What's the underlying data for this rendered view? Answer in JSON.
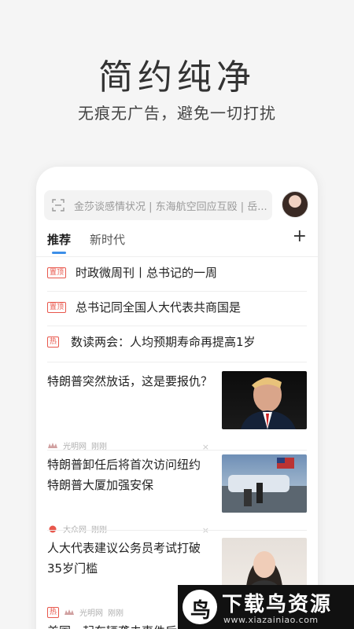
{
  "hero": {
    "title": "简约纯净",
    "subtitle": "无痕无广告，避免一切打扰"
  },
  "search": {
    "placeholder": "金莎谈感情状况 | 东海航空回应互殴 | 岳..."
  },
  "tabs": [
    {
      "label": "推荐",
      "active": true
    },
    {
      "label": "新时代",
      "active": false
    }
  ],
  "add_label": "+",
  "top_items": [
    {
      "badge": "置顶",
      "text": "时政微周刊丨总书记的一周"
    },
    {
      "badge": "置顶",
      "text": "总书记同全国人大代表共商国是"
    },
    {
      "badge": "热",
      "text": "数读两会：人均预期寿命再提高1岁"
    }
  ],
  "news": [
    {
      "title": "特朗普突然放话，这是要报仇？",
      "source": "光明网",
      "time": "刚刚"
    },
    {
      "title": "特朗普卸任后将首次访问纽约 特朗普大厦加强安保",
      "source": "大众网",
      "time": "刚刚"
    },
    {
      "title": "人大代表建议公务员考试打破35岁门槛",
      "badge": "热",
      "source": "光明网",
      "time": "刚刚"
    }
  ],
  "partial_title": "美国一起车辆袭击事件后",
  "close_label": "×",
  "watermark": {
    "logo_char": "鸟",
    "text": "下载鸟资源",
    "url": "www.xiazainiao.com"
  },
  "colors": {
    "accent": "#3d8fe8",
    "badge_red": "#e8574c"
  }
}
